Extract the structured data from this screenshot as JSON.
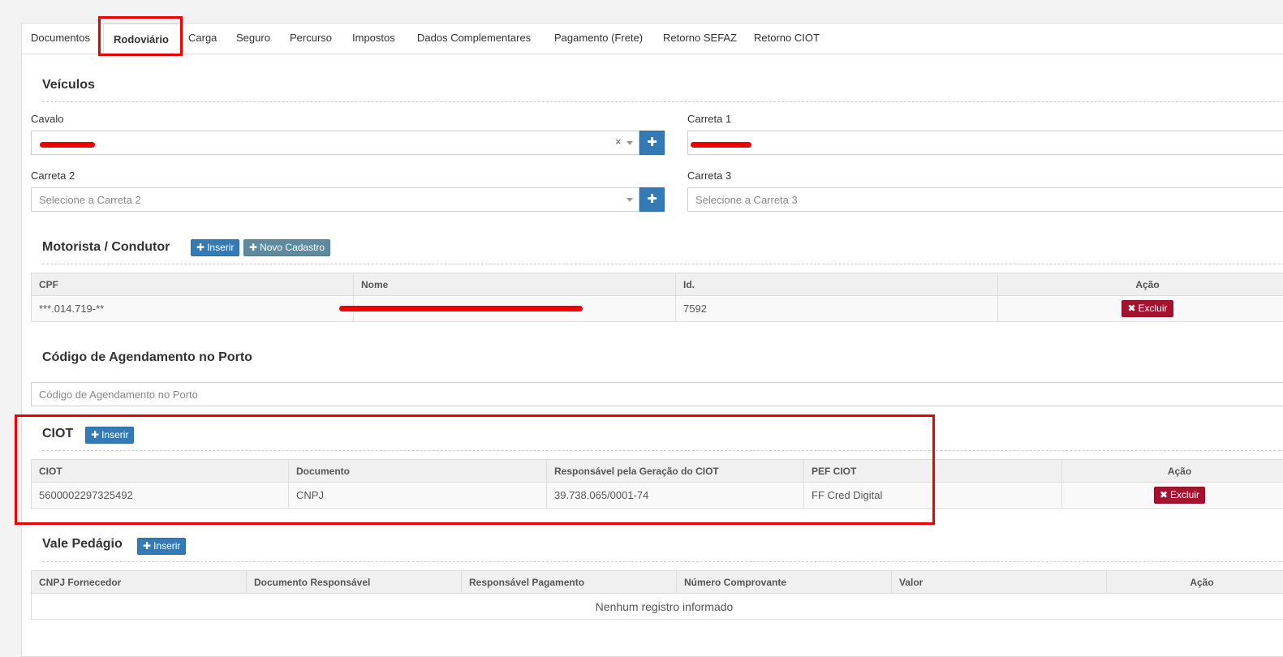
{
  "tabs": [
    "Documentos",
    "Rodoviário",
    "Carga",
    "Seguro",
    "Percurso",
    "Impostos",
    "Dados Complementares",
    "Pagamento (Frete)",
    "Retorno SEFAZ",
    "Retorno CIOT"
  ],
  "veiculos": {
    "title": "Veículos",
    "cavalo_label": "Cavalo",
    "carreta1_label": "Carreta 1",
    "carreta2_label": "Carreta 2",
    "carreta2_placeholder": "Selecione a Carreta 2",
    "carreta3_label": "Carreta 3",
    "carreta3_placeholder": "Selecione a Carreta 3",
    "clear_symbol": "×",
    "add_symbol": "✚"
  },
  "motorista": {
    "title": "Motorista / Condutor",
    "insert_label": "Inserir",
    "new_label": "Novo Cadastro",
    "columns": [
      "CPF",
      "Nome",
      "Id.",
      "Ação"
    ],
    "rows": [
      {
        "cpf": "***.014.719-**",
        "id": "7592",
        "action": "Excluir"
      }
    ]
  },
  "agendamento": {
    "title": "Código de Agendamento no Porto",
    "placeholder": "Código de Agendamento no Porto"
  },
  "ciot": {
    "title": "CIOT",
    "insert_label": "Inserir",
    "columns": [
      "CIOT",
      "Documento",
      "Responsável pela Geração do CIOT",
      "PEF CIOT",
      "Ação"
    ],
    "rows": [
      {
        "ciot": "5600002297325492",
        "documento": "CNPJ",
        "responsavel": "39.738.065/0001-74",
        "pef": "FF Cred Digital",
        "action": "Excluir"
      }
    ]
  },
  "vale_pedagio": {
    "title": "Vale Pedágio",
    "insert_label": "Inserir",
    "columns": [
      "CNPJ Fornecedor",
      "Documento Responsável",
      "Responsável Pagamento",
      "Número Comprovante",
      "Valor",
      "Ação"
    ],
    "empty": "Nenhum registro informado"
  },
  "icons": {
    "plus": "✚",
    "remove": "✖"
  },
  "colors": {
    "primary": "#337ab7",
    "danger": "#a5122f",
    "highlight": "#e00000",
    "secondary": "#5e8aa0"
  }
}
